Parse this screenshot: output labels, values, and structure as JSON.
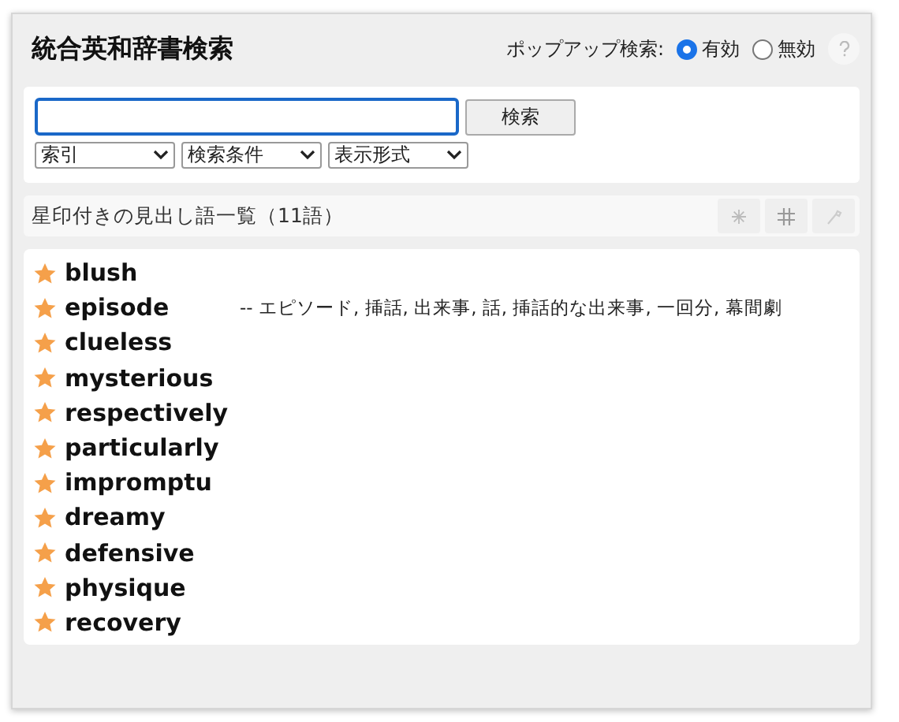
{
  "title": "統合英和辞書検索",
  "popup_search": {
    "label": "ポップアップ検索:",
    "options": [
      {
        "label": "有効",
        "selected": true
      },
      {
        "label": "無効",
        "selected": false
      }
    ]
  },
  "search": {
    "button": "検索",
    "selects": [
      "索引",
      "検索条件",
      "表示形式"
    ]
  },
  "list": {
    "heading": "星印付きの見出し語一覧（11語）",
    "items": [
      {
        "word": "blush"
      },
      {
        "word": "episode",
        "meaning": "-- エピソード, 挿話, 出来事, 話, 挿話的な出来事, 一回分, 幕間劇"
      },
      {
        "word": "clueless"
      },
      {
        "word": "mysterious"
      },
      {
        "word": "respectively"
      },
      {
        "word": "particularly"
      },
      {
        "word": "impromptu"
      },
      {
        "word": "dreamy"
      },
      {
        "word": "defensive"
      },
      {
        "word": "physique"
      },
      {
        "word": "recovery"
      }
    ]
  }
}
